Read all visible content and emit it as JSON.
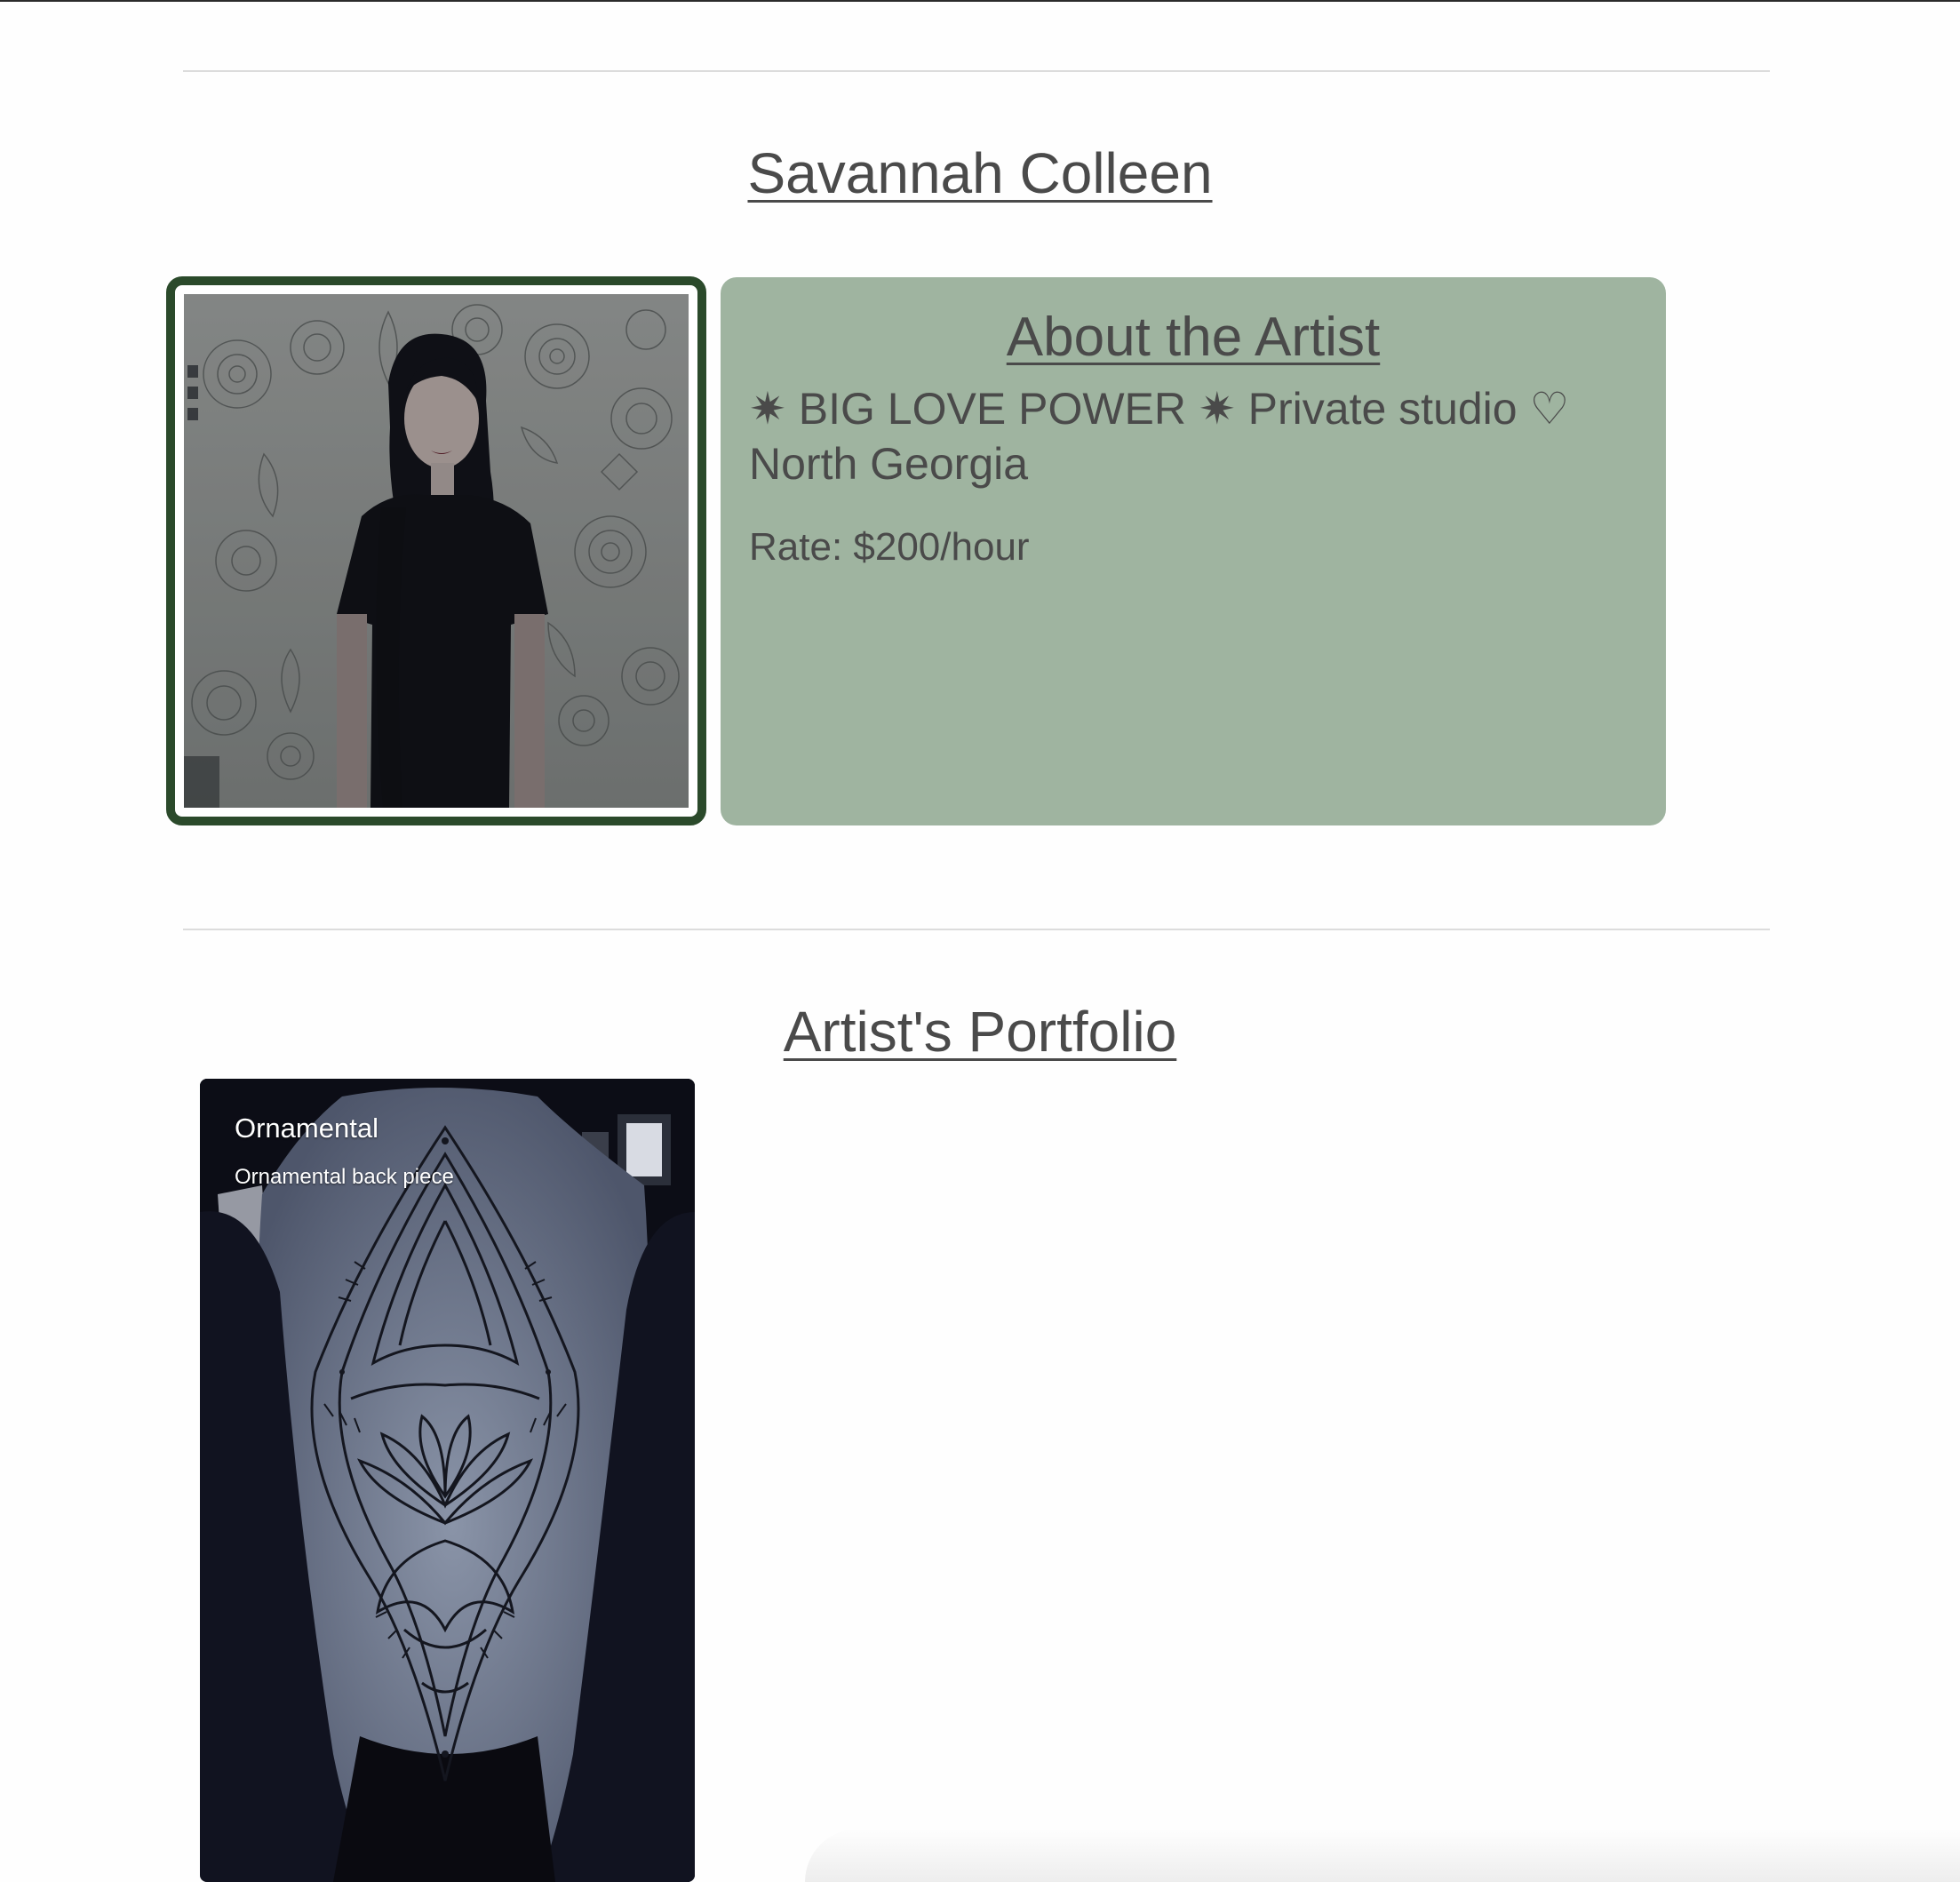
{
  "artist": {
    "name": "Savannah Colleen",
    "photo_alt": "Portrait of Savannah Colleen"
  },
  "about": {
    "title": "About the Artist",
    "bio": "✷ BIG LOVE POWER ✷ Private studio ♡ North Georgia",
    "rate": "Rate: $200/hour"
  },
  "portfolio": {
    "title": "Artist's Portfolio",
    "items": [
      {
        "title": "Ornamental",
        "description": "Ornamental back piece"
      }
    ]
  },
  "colors": {
    "page_background": "#fefefe",
    "text": "#4a4a4a",
    "about_card": "#9fb4a0",
    "photo_frame": "#2b4a2b",
    "divider": "#dcdcdc"
  }
}
